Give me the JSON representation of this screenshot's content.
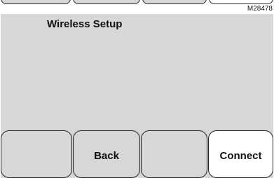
{
  "figure_id": "M28478",
  "screen": {
    "title": "Wireless Setup"
  },
  "softkeys": [
    {
      "label": ""
    },
    {
      "label": "Back"
    },
    {
      "label": ""
    },
    {
      "label": "Connect"
    }
  ],
  "colors": {
    "screen_background": "#d7d7d7",
    "highlight_key": "#ffffff",
    "border": "#222222",
    "text": "#111111"
  }
}
